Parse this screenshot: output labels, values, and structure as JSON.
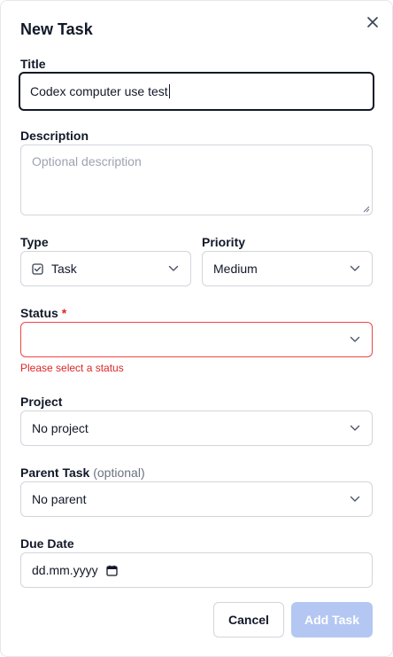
{
  "dialog": {
    "title": "New Task",
    "close_icon": "close-icon"
  },
  "form": {
    "title": {
      "label": "Title",
      "value": "Codex computer use test"
    },
    "description": {
      "label": "Description",
      "placeholder": "Optional description",
      "value": ""
    },
    "type": {
      "label": "Type",
      "value": "Task",
      "icon": "checkbox-icon"
    },
    "priority": {
      "label": "Priority",
      "value": "Medium"
    },
    "status": {
      "label": "Status",
      "required_marker": "*",
      "value": "",
      "error": "Please select a status"
    },
    "project": {
      "label": "Project",
      "value": "No project"
    },
    "parent_task": {
      "label": "Parent Task",
      "optional_hint": "(optional)",
      "value": "No parent"
    },
    "due_date": {
      "label": "Due Date",
      "placeholder": "dd.mm.yyyy",
      "icon": "calendar-icon"
    }
  },
  "actions": {
    "cancel_label": "Cancel",
    "submit_label": "Add Task"
  },
  "colors": {
    "error": "#dc2626",
    "primary_disabled": "#b3c7f2",
    "focus_border": "#111827"
  }
}
